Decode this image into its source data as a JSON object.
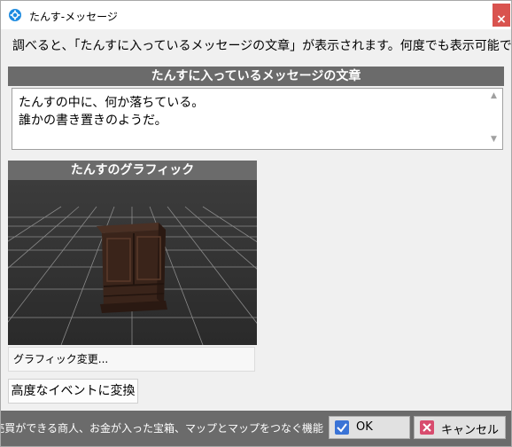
{
  "window": {
    "title": "たんす-メッセージ",
    "close_label": "×"
  },
  "description": "調べると、「たんすに入っているメッセージの文章」が表示されます。何度でも表示可能です。",
  "message_section": {
    "header": "たんすに入っているメッセージの文章",
    "text": "たんすの中に、何か落ちている。\n誰かの書き置きのようだ。"
  },
  "graphic_section": {
    "header": "たんすのグラフィック",
    "change_button": "グラフィック変更..."
  },
  "advanced_button": "高度なイベントに変換",
  "footer": {
    "hint": "ゲームの売買ができる商人、お金が入った宝箱、マップとマップをつなぐ機能",
    "ok_label": "OK",
    "cancel_label": "キャンセル"
  },
  "colors": {
    "header_bg": "#6b6b6b",
    "ok_icon": "#3a73d6",
    "cancel_icon": "#d84c6e"
  }
}
